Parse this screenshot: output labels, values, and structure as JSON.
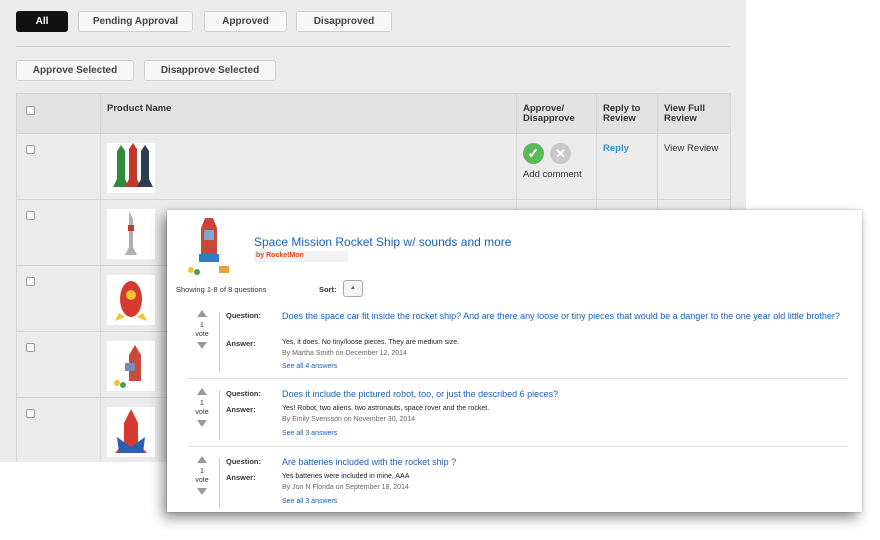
{
  "filters": {
    "all": "All",
    "pending": "Pending Approval",
    "approved": "Approved",
    "disapproved": "Disapproved"
  },
  "actions": {
    "approve_selected": "Approve Selected",
    "disapprove_selected": "Disapprove Selected"
  },
  "table": {
    "headers": {
      "product_name": "Product Name",
      "approve_disapprove": "Approve/ Disapprove",
      "reply": "Reply to Review",
      "view": "View Full Review"
    },
    "row1": {
      "add_comment": "Add comment",
      "reply_link": "Reply",
      "view_link": "View Review"
    }
  },
  "review_card": {
    "product_title": "Space Mission Rocket Ship w/ sounds and more",
    "byline": "by RocketMon",
    "showing": "Showing 1-8 of 8 questions",
    "sort_label": "Sort:",
    "question_label": "Question:",
    "answer_label": "Answer:",
    "questions": [
      {
        "votes": "1",
        "vote_word": "vote",
        "question": "Does the space car fit inside the rocket ship? And are there any loose or tiny pieces that would be a danger to the one year old little brother?",
        "answer": "Yes, it does. No tiny/loose pieces. They are medium size.",
        "by": "By Martha Smith on December 12, 2014",
        "see_all": "See all 4 answers"
      },
      {
        "votes": "1",
        "vote_word": "vote",
        "question": "Does it include the pictured robot, too, or just the described 6 pieces?",
        "answer": "Yes! Robot, two aliens, two astronauts, space rover and the rocket.",
        "by": "By Emily Svensson on November 30, 2014",
        "see_all": "See all 3 answers"
      },
      {
        "votes": "1",
        "vote_word": "vote",
        "question": "Are batteries included with the rocket ship ?",
        "answer": "Yes batteries were included in mine, AAA",
        "by": "By Jon N Florida on September 18, 2014",
        "see_all": "See all 3 answers"
      }
    ]
  },
  "colors": {
    "accent_link": "#1a5fb4",
    "approve_green": "#5cb85c",
    "byline_orange": "#d94a1a"
  }
}
